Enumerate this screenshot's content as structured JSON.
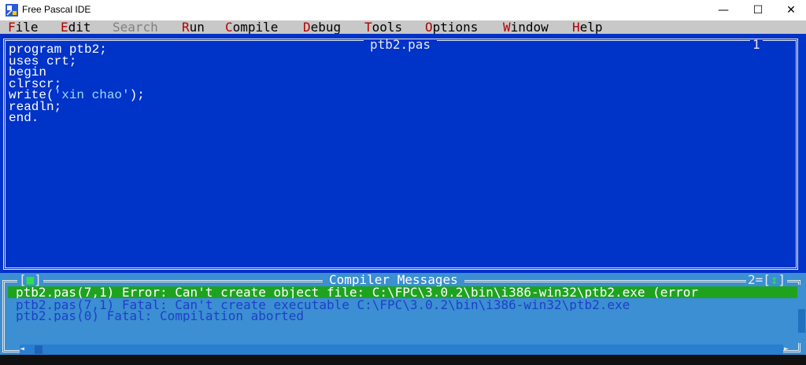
{
  "window": {
    "title": "Free Pascal IDE",
    "controls": {
      "minimize": "—",
      "maximize": "☐",
      "close": "✕"
    }
  },
  "menu": [
    {
      "name": "file",
      "hot": "F",
      "rest": "ile",
      "enabled": true
    },
    {
      "name": "edit",
      "hot": "E",
      "rest": "dit",
      "enabled": true
    },
    {
      "name": "search",
      "hot": "",
      "rest": "Search",
      "enabled": false
    },
    {
      "name": "run",
      "hot": "R",
      "rest": "un",
      "enabled": true
    },
    {
      "name": "compile",
      "hot": "C",
      "rest": "ompile",
      "enabled": true
    },
    {
      "name": "debug",
      "hot": "D",
      "rest": "ebug",
      "enabled": true
    },
    {
      "name": "tools",
      "hot": "T",
      "rest": "ools",
      "enabled": true
    },
    {
      "name": "options",
      "hot": "O",
      "rest": "ptions",
      "enabled": true
    },
    {
      "name": "window",
      "hot": "W",
      "rest": "indow",
      "enabled": true
    },
    {
      "name": "help",
      "hot": "H",
      "rest": "elp",
      "enabled": true
    }
  ],
  "editor": {
    "filename": "ptb2.pas",
    "window_number": "1",
    "code": {
      "line1": "program ptb2;",
      "line2": "uses crt;",
      "line3": "begin",
      "line4": "clrscr;",
      "line5_pre": "write(",
      "line5_str": "'xin chao'",
      "line5_post": ");",
      "line6": "readln;",
      "line7": "end."
    }
  },
  "messages": {
    "title": "Compiler Messages",
    "close_left": "[",
    "close_mid": "■",
    "close_right": "]",
    "window_number_prefix": "2=[",
    "window_number_arrow": "↕",
    "window_number_suffix": "]",
    "items": [
      "ptb2.pas(7,1) Error: Can't create object file: C:\\FPC\\3.0.2\\bin\\i386-win32\\ptb2.exe (error",
      "ptb2.pas(7,1) Fatal: Can't create executable C:\\FPC\\3.0.2\\bin\\i386-win32\\ptb2.exe",
      "ptb2.pas(0) Fatal: Compilation aborted"
    ],
    "scroll": {
      "left": "◄",
      "right": "►"
    }
  },
  "colors": {
    "editor_bg": "#0033c8",
    "messages_bg": "#3b8fd2",
    "selected_bg": "#1fa31f",
    "menu_bg": "#c8c8c8",
    "hotkey": "#b30000"
  }
}
